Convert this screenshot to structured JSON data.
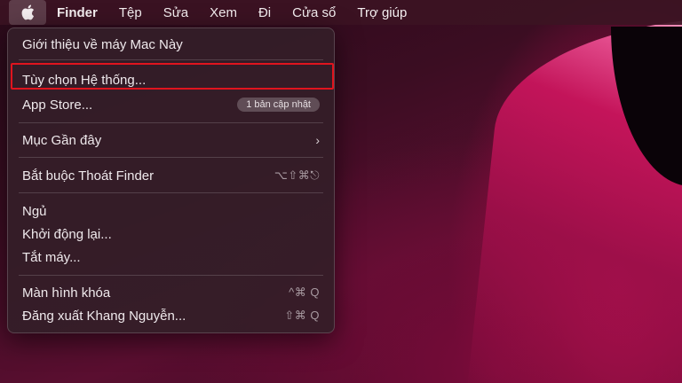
{
  "menubar": {
    "apple_icon": "apple-logo-icon",
    "items": [
      {
        "label": "Finder"
      },
      {
        "label": "Tệp"
      },
      {
        "label": "Sửa"
      },
      {
        "label": "Xem"
      },
      {
        "label": "Đi"
      },
      {
        "label": "Cửa sổ"
      },
      {
        "label": "Trợ giúp"
      }
    ]
  },
  "apple_menu": {
    "about": "Giới thiệu về máy Mac Này",
    "system_settings": "Tùy chọn Hệ thống...",
    "app_store": "App Store...",
    "app_store_badge": "1 bản cập nhật",
    "recent_items": "Mục Gần đây",
    "recent_chevron": "›",
    "force_quit": "Bắt buộc Thoát Finder",
    "force_quit_shortcut": "⌥⇧⌘⎋",
    "sleep": "Ngủ",
    "restart": "Khởi động lại...",
    "shutdown": "Tắt máy...",
    "lock_screen": "Màn hình khóa",
    "lock_screen_shortcut": "^⌘ Q",
    "logout": "Đăng xuất Khang Nguyễn...",
    "logout_shortcut": "⇧⌘ Q"
  },
  "colors": {
    "highlight_border": "#e0141e",
    "menubar_bg": "#3c1423",
    "menu_bg": "#341e28"
  }
}
